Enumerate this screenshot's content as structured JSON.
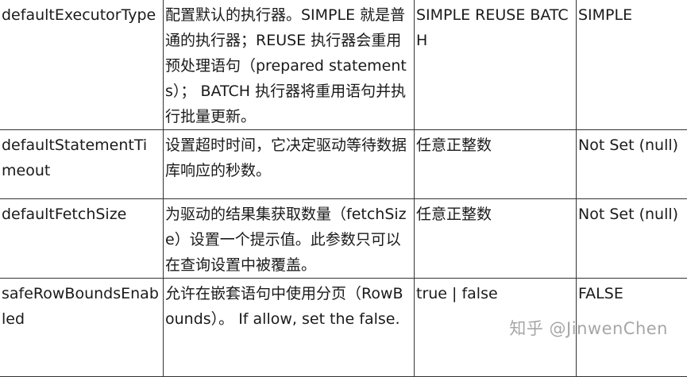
{
  "rows": [
    {
      "name": "defaultExecutorType",
      "description": "配置默认的执行器。SIMPLE 就是普通的执行器；REUSE 执行器会重用预处理语句（prepared statements）； BATCH 执行器将重用语句并执行批量更新。",
      "values": "SIMPLE REUSE BATCH",
      "default": "SIMPLE"
    },
    {
      "name": "defaultStatementTimeout",
      "description": "设置超时时间，它决定驱动等待数据库响应的秒数。",
      "values": "任意正整数",
      "default": "Not Set (null)"
    },
    {
      "name": "defaultFetchSize",
      "description": "为驱动的结果集获取数量（fetchSize）设置一个提示值。此参数只可以在查询设置中被覆盖。",
      "values": "任意正整数",
      "default": "Not Set (null)"
    },
    {
      "name": "safeRowBoundsEnabled",
      "description": "允许在嵌套语句中使用分页（RowBounds）。 If allow, set the false.",
      "values": "true | false",
      "default": "FALSE"
    }
  ],
  "watermark": "知乎 @JinwenChen"
}
